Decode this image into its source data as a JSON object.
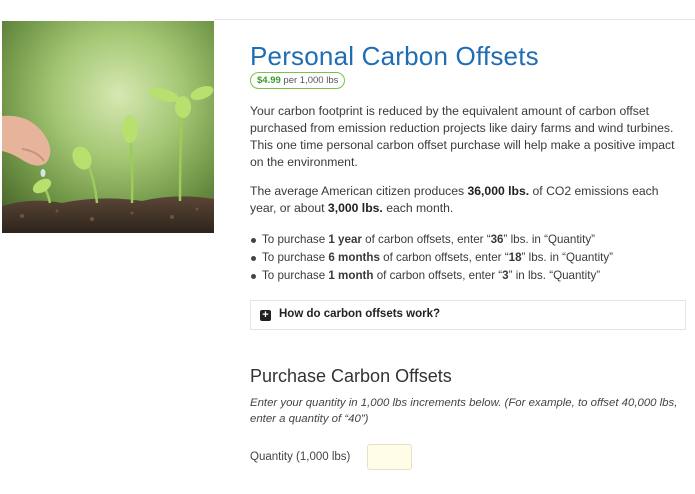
{
  "product": {
    "title": "Personal Carbon Offsets",
    "price_amount": "$4.99",
    "price_unit": "per 1,000 lbs",
    "image_subject": "seedlings sprouting from soil"
  },
  "description": {
    "paragraph1": "Your carbon footprint is reduced by the equivalent amount of carbon offset purchased from emission reduction projects like dairy farms and wind turbines. This one time personal carbon offset purchase will help make a positive impact on the environment.",
    "p2_part1": "The average American citizen produces ",
    "p2_bold1": "36,000 lbs.",
    "p2_part2": " of CO2 emissions each year, or about ",
    "p2_bold2": "3,000 lbs.",
    "p2_part3": " each month."
  },
  "bullets": [
    {
      "pre": "To purchase ",
      "bold1": "1 year",
      "mid": " of carbon offsets, enter “",
      "bold2": "36",
      "post": "” lbs. in “Quantity”"
    },
    {
      "pre": "To purchase ",
      "bold1": "6 months",
      "mid": " of carbon offsets, enter “",
      "bold2": "18",
      "post": "” lbs. in “Quantity”"
    },
    {
      "pre": "To purchase ",
      "bold1": "1 month",
      "mid": " of carbon offsets, enter “",
      "bold2": "3",
      "post": "” in lbs. “Quantity”"
    }
  ],
  "faq": {
    "label": "How do carbon offsets work?",
    "icon": "plus-square-icon"
  },
  "purchase": {
    "section_title": "Purchase Carbon Offsets",
    "instructions": "Enter your quantity in 1,000 lbs increments below.  (For example, to offset 40,000 lbs, enter a quantity of “40”)",
    "quantity_label": "Quantity (1,000 lbs)",
    "quantity_value": ""
  },
  "colors": {
    "title": "#1f6db3",
    "price_border": "#7cc24a",
    "price_amount": "#3d9a2a",
    "input_bg": "#fffde8"
  }
}
